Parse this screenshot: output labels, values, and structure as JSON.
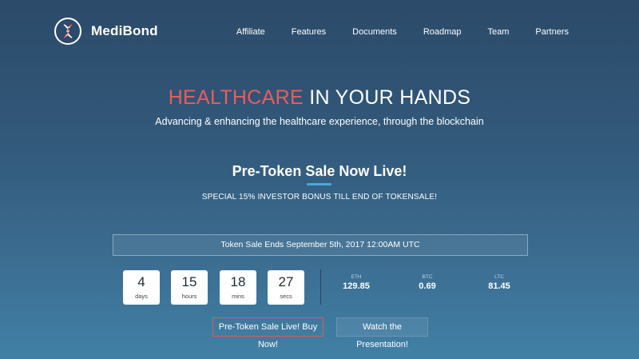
{
  "brand": {
    "name": "MediBond",
    "logo_icon": "dna-helix-icon"
  },
  "nav": {
    "items": [
      "Affiliate",
      "Features",
      "Documents",
      "Roadmap",
      "Team",
      "Partners"
    ]
  },
  "hero": {
    "title_accent": "HEALTHCARE",
    "title_rest": " IN YOUR HANDS",
    "subtitle": "Advancing & enhancing the healthcare experience, through the blockchain"
  },
  "presale": {
    "title": "Pre-Token Sale Now Live!",
    "bonus": "SPECIAL 15% INVESTOR BONUS TILL END OF TOKENSALE!"
  },
  "countdown": {
    "ends_text": "Token Sale Ends September 5th, 2017 12:00AM UTC",
    "units": [
      {
        "value": "4",
        "label": "days"
      },
      {
        "value": "15",
        "label": "hours"
      },
      {
        "value": "18",
        "label": "mins"
      },
      {
        "value": "27",
        "label": "secs"
      }
    ]
  },
  "prices": [
    {
      "currency": "ETH",
      "value": "129.85"
    },
    {
      "currency": "BTC",
      "value": "0.69"
    },
    {
      "currency": "LTC",
      "value": "81.45"
    }
  ],
  "buttons": {
    "buy_label": "Pre-Token Sale Live! Buy Now!",
    "watch_label": "Watch the Presentation!"
  },
  "colors": {
    "accent_red": "#e85d5f",
    "accent_blue": "#4aa8df",
    "bg_top": "#2c4a69",
    "bg_bottom": "#4180a6"
  }
}
